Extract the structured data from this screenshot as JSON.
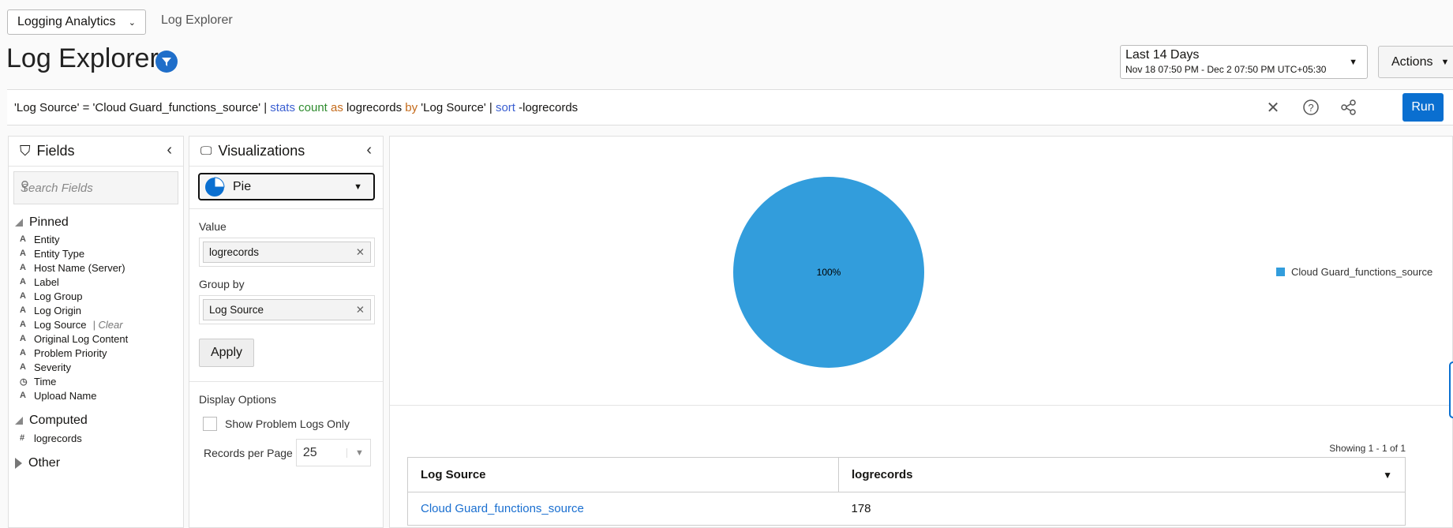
{
  "header": {
    "app_select": "Logging Analytics",
    "breadcrumb": "Log Explorer",
    "title": "Log Explorer"
  },
  "time_range": {
    "label": "Last 14 Days",
    "detail": "Nov 18 07:50 PM - Dec 2 07:50 PM UTC+05:30"
  },
  "actions_label": "Actions",
  "query": {
    "parts": [
      {
        "text": "'Log Source' = 'Cloud Guard_functions_source' | ",
        "cls": ""
      },
      {
        "text": "stats ",
        "cls": "kw-blue"
      },
      {
        "text": "count ",
        "cls": "kw-green"
      },
      {
        "text": "as ",
        "cls": "kw-orange"
      },
      {
        "text": "logrecords ",
        "cls": ""
      },
      {
        "text": "by ",
        "cls": "kw-orange"
      },
      {
        "text": "'Log Source' | ",
        "cls": ""
      },
      {
        "text": "sort ",
        "cls": "kw-blue"
      },
      {
        "text": "-logrecords",
        "cls": ""
      }
    ],
    "run_label": "Run"
  },
  "fields": {
    "title": "Fields",
    "search_placeholder": "Search Fields",
    "pinned_label": "Pinned",
    "pinned": [
      {
        "type": "A",
        "label": "Entity"
      },
      {
        "type": "A",
        "label": "Entity Type"
      },
      {
        "type": "A",
        "label": "Host Name (Server)"
      },
      {
        "type": "A",
        "label": "Label"
      },
      {
        "type": "A",
        "label": "Log Group"
      },
      {
        "type": "A",
        "label": "Log Origin"
      },
      {
        "type": "A",
        "label": "Log Source",
        "clear": "| Clear"
      },
      {
        "type": "A",
        "label": "Original Log Content"
      },
      {
        "type": "A",
        "label": "Problem Priority"
      },
      {
        "type": "A",
        "label": "Severity"
      },
      {
        "type": "◷",
        "label": "Time"
      },
      {
        "type": "A",
        "label": "Upload Name"
      }
    ],
    "computed_label": "Computed",
    "computed": [
      {
        "type": "#",
        "label": "logrecords"
      }
    ],
    "other_label": "Other"
  },
  "visualizations": {
    "title": "Visualizations",
    "type": "Pie",
    "value_label": "Value",
    "value": "logrecords",
    "group_label": "Group by",
    "group": "Log Source",
    "apply_label": "Apply",
    "display_options_label": "Display Options",
    "problem_logs_label": "Show Problem Logs Only",
    "problem_logs_checked": false,
    "records_label": "Records per Page",
    "records_value": "25"
  },
  "colors": {
    "pie": "#329ddc",
    "accent": "#0a6fd0"
  },
  "chart_data": {
    "type": "pie",
    "categories": [
      "Cloud Guard_functions_source"
    ],
    "values": [
      178
    ],
    "labels": [
      "100%"
    ],
    "legend": "right"
  },
  "table": {
    "showing": "Showing 1 - 1 of 1",
    "columns": [
      "Log Source",
      "logrecords"
    ],
    "rows": [
      [
        "Cloud Guard_functions_source",
        "178"
      ]
    ]
  }
}
